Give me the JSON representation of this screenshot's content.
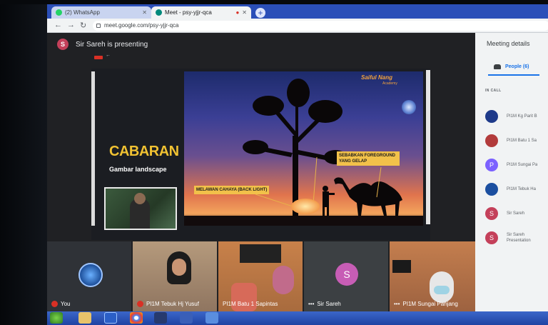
{
  "browser": {
    "tabs": [
      {
        "label": "(2) WhatsApp",
        "active": false,
        "icon": "whatsapp-icon",
        "color": "#25d366"
      },
      {
        "label": "Meet - psy-yjjr-qca",
        "active": true,
        "icon": "meet-icon",
        "color": "#00897b"
      }
    ],
    "url": "meet.google.com/psy-yjjr-qca"
  },
  "meet": {
    "presenter_initial": "S",
    "presenting_text": "Sir Sareh is presenting",
    "slide": {
      "title": "CABARAN",
      "subtitle": "Gambar landscape",
      "brand": "Saiful Nang",
      "brand_sub": "Academy",
      "label_backlight": "MELAWAN CAHAYA (BACK LIGHT)",
      "label_foreground": "SEBABKAN FOREGROUND YANG GELAP"
    },
    "tiles": [
      {
        "name": "You",
        "type": "logo"
      },
      {
        "name": "PI1M Tebuk Hj Yusuf",
        "type": "video"
      },
      {
        "name": "PI1M Batu 1 Sapintas",
        "type": "video"
      },
      {
        "name": "Sir Sareh",
        "type": "avatar",
        "initial": "S"
      },
      {
        "name": "PI1M Sungai Panjang",
        "type": "video"
      }
    ]
  },
  "panel": {
    "title": "Meeting details",
    "people_tab": "People (6)",
    "section": "IN CALL",
    "people": [
      {
        "name": "PI1M Kg Parit B",
        "color": "#1e3a8a",
        "initial": ""
      },
      {
        "name": "PI1M Batu 1 Sa",
        "color": "#b23b3b",
        "initial": ""
      },
      {
        "name": "PI1M Sungai Pa",
        "color": "#7b61ff",
        "initial": "P"
      },
      {
        "name": "PI1M Tebuk Ha",
        "color": "#1b4fa0",
        "initial": ""
      },
      {
        "name": "Sir Sareh",
        "color": "#c4405a",
        "initial": "S"
      },
      {
        "name": "Sir Sareh",
        "name2": "Presentation",
        "color": "#c4405a",
        "initial": "S"
      }
    ]
  }
}
